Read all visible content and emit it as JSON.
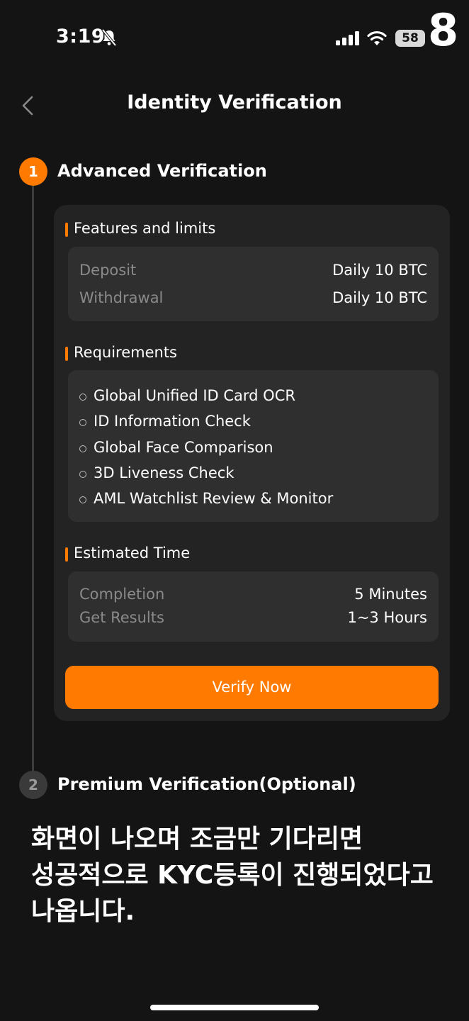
{
  "status_bar": {
    "time": "3:19",
    "battery": "58",
    "badge": "8"
  },
  "nav": {
    "title": "Identity Verification"
  },
  "steps": [
    {
      "number": "1",
      "title": "Advanced Verification"
    },
    {
      "number": "2",
      "title": "Premium Verification(Optional)"
    }
  ],
  "features": {
    "heading": "Features and limits",
    "rows": [
      {
        "label": "Deposit",
        "value": "Daily 10 BTC"
      },
      {
        "label": "Withdrawal",
        "value": "Daily 10 BTC"
      }
    ]
  },
  "requirements": {
    "heading": "Requirements",
    "items": [
      "Global Unified ID Card OCR",
      "ID Information Check",
      "Global Face Comparison",
      "3D Liveness Check",
      "AML Watchlist Review & Monitor"
    ]
  },
  "estimated": {
    "heading": "Estimated Time",
    "rows": [
      {
        "label": "Completion",
        "value": "5 Minutes"
      },
      {
        "label": "Get Results",
        "value": "1~3 Hours"
      }
    ]
  },
  "verify_button": "Verify Now",
  "caption": {
    "lines": [
      "화면이 나오며 조금만 기다리면",
      "성공적으로 KYC등록이 진행되었다고",
      "나옵니다."
    ]
  },
  "colors": {
    "accent": "#ff7a00",
    "background": "#141414",
    "card": "#232323",
    "box": "#2f2f2f"
  }
}
